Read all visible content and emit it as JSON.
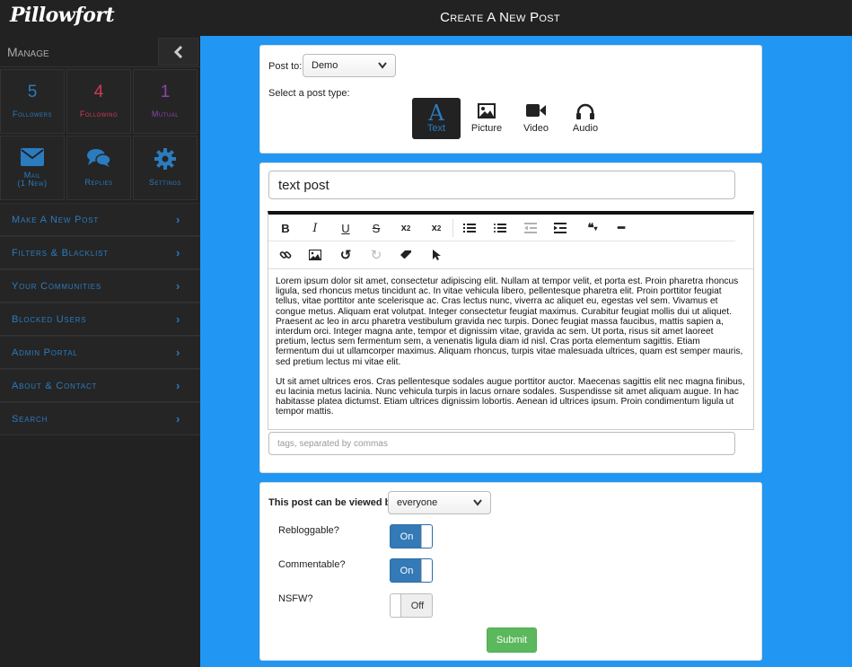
{
  "app": {
    "logo": "Pillowfort",
    "page_title": "Create A New Post"
  },
  "colors": {
    "accent": "#2b7bbf",
    "background": "#2196f3",
    "following": "#d23a56",
    "mutual": "#8e44ad",
    "submit": "#5cb85c"
  },
  "sidebar": {
    "manage_label": "Manage",
    "collapse_icon": "chevron-left-icon",
    "stats": [
      {
        "count": "5",
        "label": "Followers",
        "color": "#2b7bbf"
      },
      {
        "count": "4",
        "label": "Following",
        "color": "#d23a56"
      },
      {
        "count": "1",
        "label": "Mutual",
        "color": "#8e44ad"
      }
    ],
    "actions": [
      {
        "label": "Mail",
        "sublabel": "(1 New)",
        "icon": "envelope-icon"
      },
      {
        "label": "Replies",
        "icon": "comments-icon"
      },
      {
        "label": "Settings",
        "icon": "gear-icon"
      }
    ],
    "menu": [
      {
        "label": "Make A New Post"
      },
      {
        "label": "Filters & Blacklist"
      },
      {
        "label": "Your Communities"
      },
      {
        "label": "Blocked Users"
      },
      {
        "label": "Admin Portal"
      },
      {
        "label": "About & Contact"
      },
      {
        "label": "Search"
      }
    ]
  },
  "post_setup": {
    "post_to_label": "Post to:",
    "post_to_value": "Demo",
    "post_type_label": "Select a post type:",
    "types": [
      {
        "label": "Text",
        "icon": "text-font-icon",
        "active": true
      },
      {
        "label": "Picture",
        "icon": "picture-icon",
        "active": false
      },
      {
        "label": "Video",
        "icon": "video-camera-icon",
        "active": false
      },
      {
        "label": "Audio",
        "icon": "headphones-icon",
        "active": false
      }
    ]
  },
  "editor": {
    "title_value": "text post",
    "toolbar": {
      "row1": [
        "bold-icon",
        "italic-icon",
        "underline-icon",
        "strikethrough-icon",
        "subscript-icon",
        "superscript-icon",
        "ordered-list-icon",
        "unordered-list-icon",
        "outdent-icon",
        "indent-icon",
        "blockquote-icon",
        "horizontal-rule-icon"
      ],
      "row2": [
        "link-icon",
        "image-icon",
        "undo-icon",
        "redo-icon",
        "eraser-icon",
        "pointer-icon"
      ]
    },
    "paragraphs": [
      "Lorem ipsum dolor sit amet, consectetur adipiscing elit. Nullam at tempor velit, et porta est. Proin pharetra rhoncus ligula, sed rhoncus metus tincidunt ac. In vitae vehicula libero, pellentesque pharetra elit. Proin porttitor feugiat tellus, vitae porttitor ante scelerisque ac. Cras lectus nunc, viverra ac aliquet eu, egestas vel sem. Vivamus et congue metus. Aliquam erat volutpat. Integer consectetur feugiat maximus. Curabitur feugiat mollis dui ut aliquet. Praesent ac leo in arcu pharetra vestibulum gravida nec turpis. Donec feugiat massa faucibus, mattis sapien a, interdum orci. Integer magna ante, tempor et dignissim vitae, gravida ac sem. Ut porta, risus sit amet laoreet pretium, lectus sem fermentum sem, a venenatis ligula diam id nisl. Cras porta elementum sagittis. Etiam fermentum dui ut ullamcorper maximus. Aliquam rhoncus, turpis vitae malesuada ultrices, quam est semper mauris, sed pretium lectus mi vitae elit.",
      "Ut sit amet ultrices eros. Cras pellentesque sodales augue porttitor auctor. Maecenas sagittis elit nec magna finibus, eu lacinia metus lacinia. Nunc vehicula turpis in lacus ornare sodales. Suspendisse sit amet aliquam augue. In hac habitasse platea dictumst. Etiam ultrices dignissim lobortis. Aenean id ultrices ipsum. Proin condimentum ligula ut tempor mattis."
    ],
    "tags_placeholder": "tags, separated by commas"
  },
  "options": {
    "viewed_by_label": "This post can be viewed by:",
    "viewed_by_value": "everyone",
    "toggles": [
      {
        "label": "Rebloggable?",
        "state": "On",
        "on": true
      },
      {
        "label": "Commentable?",
        "state": "On",
        "on": true
      },
      {
        "label": "NSFW?",
        "state": "Off",
        "on": false
      }
    ],
    "submit_label": "Submit"
  }
}
